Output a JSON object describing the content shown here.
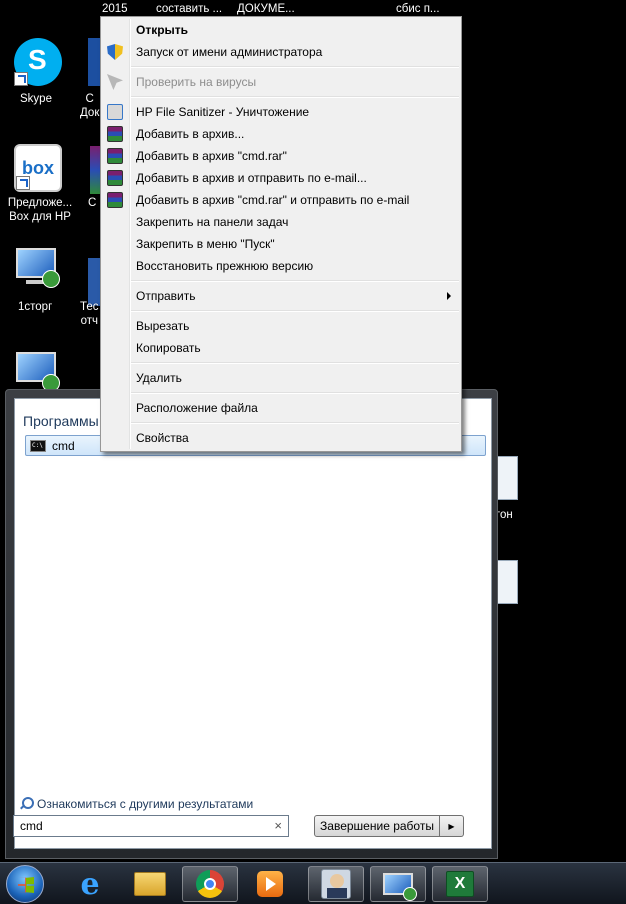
{
  "desktop": {
    "top_labels": [
      "2015",
      "составить ...",
      "ДОКУМЕ...",
      "сбис п..."
    ],
    "icons": [
      {
        "label": "Skype"
      },
      {
        "label": "Предложе... Box для HP"
      },
      {
        "label": "1сторг"
      },
      {
        "label": "С\nДок"
      },
      {
        "label": "С"
      },
      {
        "label": "Тес\nотч"
      },
      {
        "label": "гон"
      }
    ]
  },
  "context_menu": {
    "items": [
      {
        "label": "Открыть",
        "bold": true,
        "icon": "none"
      },
      {
        "label": "Запуск от имени администратора",
        "icon": "uac-shield-icon"
      },
      {
        "label": "Проверить на вирусы",
        "disabled": true,
        "icon": "antivirus-icon"
      },
      {
        "label": "HP File Sanitizer - Уничтожение",
        "icon": "hp-sanitizer-icon"
      },
      {
        "label": "Добавить в архив...",
        "icon": "winrar-icon"
      },
      {
        "label": "Добавить в архив \"cmd.rar\"",
        "icon": "winrar-icon"
      },
      {
        "label": "Добавить в архив и отправить по e-mail...",
        "icon": "winrar-icon"
      },
      {
        "label": "Добавить в архив \"cmd.rar\" и отправить по e-mail",
        "icon": "winrar-icon"
      },
      {
        "label": "Закрепить на панели задач",
        "icon": "none"
      },
      {
        "label": "Закрепить в меню \"Пуск\"",
        "icon": "none"
      },
      {
        "label": "Восстановить прежнюю версию",
        "icon": "none"
      },
      {
        "label": "Отправить",
        "submenu": true,
        "icon": "none"
      },
      {
        "label": "Вырезать",
        "icon": "none"
      },
      {
        "label": "Копировать",
        "icon": "none"
      },
      {
        "label": "Удалить",
        "icon": "none"
      },
      {
        "label": "Расположение файла",
        "icon": "none"
      },
      {
        "label": "Свойства",
        "icon": "none"
      }
    ]
  },
  "start_menu": {
    "programs_title": "Программы",
    "result_label": "cmd",
    "more_results": "Ознакомиться с другими результатами",
    "search_value": "cmd",
    "search_clear": "×",
    "shutdown_label": "Завершение работы",
    "shutdown_arrow": "▶"
  },
  "taskbar": {
    "items": [
      "start-orb",
      "internet-explorer-icon",
      "file-explorer-icon",
      "chrome-icon",
      "media-player-icon",
      "app-avatar-icon",
      "remote-desktop-icon",
      "excel-icon"
    ]
  }
}
